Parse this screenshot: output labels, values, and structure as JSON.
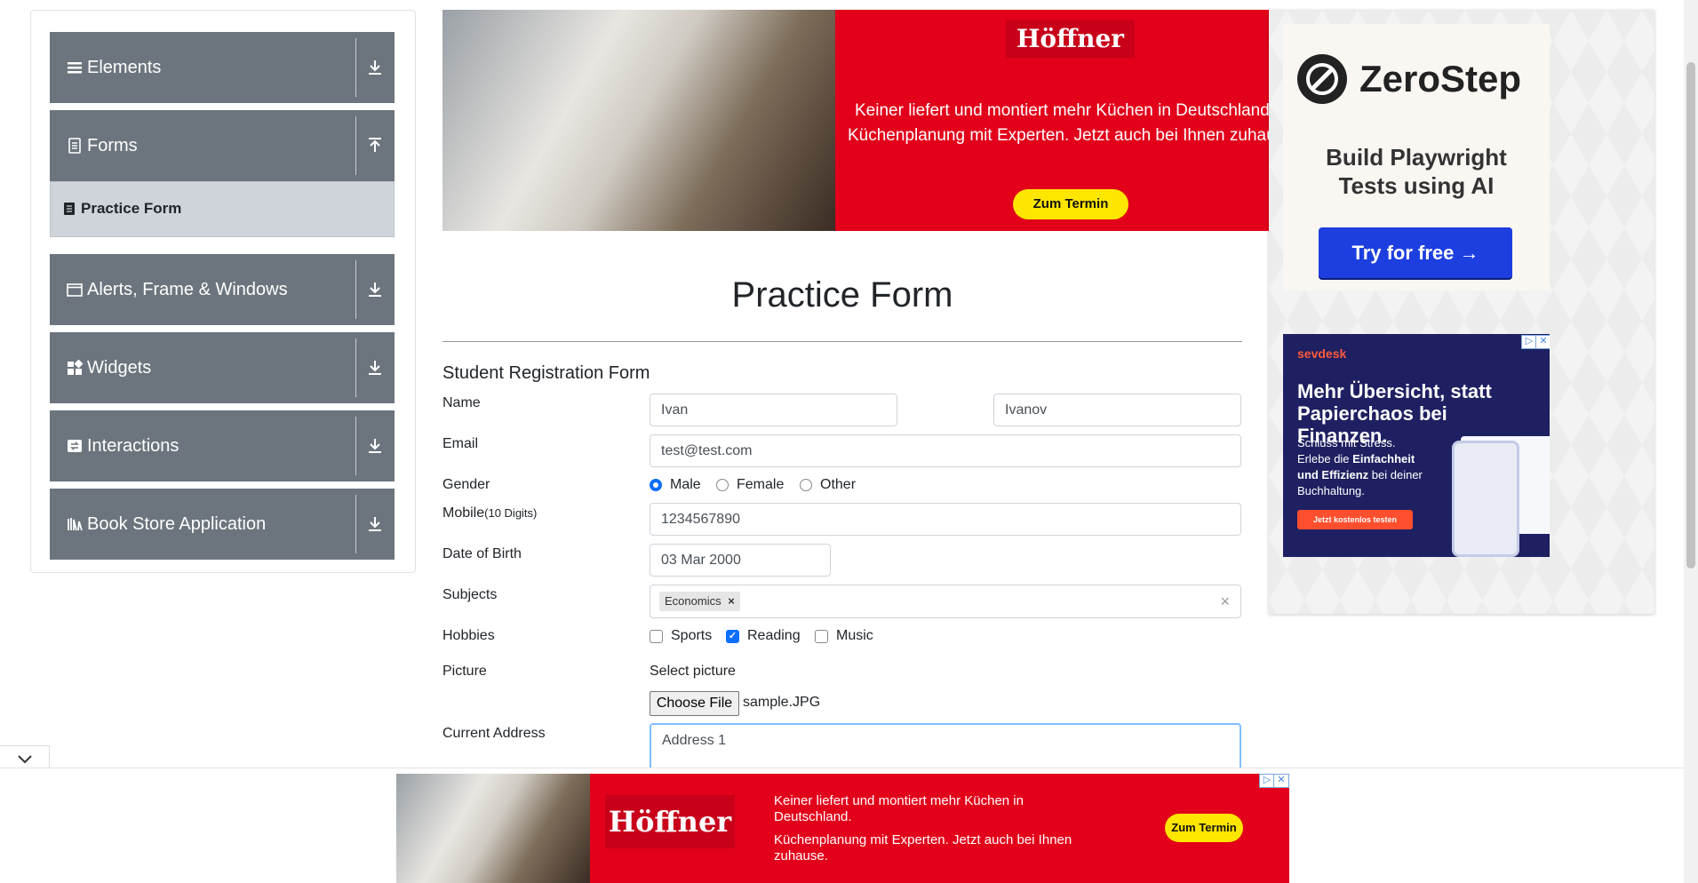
{
  "sidebar": {
    "groups": [
      {
        "label": "Elements"
      },
      {
        "label": "Forms"
      },
      {
        "label": "Alerts, Frame & Windows"
      },
      {
        "label": "Widgets"
      },
      {
        "label": "Interactions"
      },
      {
        "label": "Book Store Application"
      }
    ],
    "active_item": "Practice Form"
  },
  "top_ad": {
    "brand": "Höffner",
    "text_line1": "Keiner liefert und montiert mehr Küchen in Deutschland",
    "text_line2": "Küchenplanung mit Experten. Jetzt auch bei Ihnen zuhause",
    "cta": "Zum Termin"
  },
  "zerostep_ad": {
    "brand": "ZeroStep",
    "headline_line1": "Build Playwright",
    "headline_line2": "Tests using AI",
    "cta": "Try for free →"
  },
  "sevdesk_ad": {
    "brand": "sevdesk",
    "headline": "Mehr Übersicht, statt Papierchaos bei Finanzen.",
    "sub_plain1": "Schluss mit Stress.",
    "sub_plain2": "Erlebe die ",
    "sub_bold1": "Einfachheit",
    "sub_bold2": "und Effizienz",
    "sub_plain3": " bei deiner Buchhaltung.",
    "cta": "Jetzt kostenlos testen"
  },
  "form": {
    "title": "Practice Form",
    "subtitle": "Student Registration Form",
    "labels": {
      "name": "Name",
      "email": "Email",
      "gender": "Gender",
      "mobile": "Mobile",
      "mobile_hint": "(10 Digits)",
      "dob": "Date of Birth",
      "subjects": "Subjects",
      "hobbies": "Hobbies",
      "picture": "Picture",
      "address": "Current Address"
    },
    "first_name": "Ivan",
    "last_name": "Ivanov",
    "email": "test@test.com",
    "gender_options": [
      "Male",
      "Female",
      "Other"
    ],
    "gender_selected": "Male",
    "mobile": "1234567890",
    "dob": "03 Mar 2000",
    "subjects": [
      "Economics"
    ],
    "hobby_options": [
      "Sports",
      "Reading",
      "Music"
    ],
    "hobbies_checked": [
      "Reading"
    ],
    "picture_prompt": "Select picture",
    "choose_file": "Choose File",
    "file_name": "sample.JPG",
    "address": "Address 1"
  },
  "bottom_ad": {
    "brand": "Höffner",
    "text_line1": "Keiner liefert und montiert mehr Küchen in Deutschland.",
    "text_line2": "Küchenplanung mit Experten. Jetzt auch bei Ihnen zuhause.",
    "cta": "Zum Termin"
  }
}
